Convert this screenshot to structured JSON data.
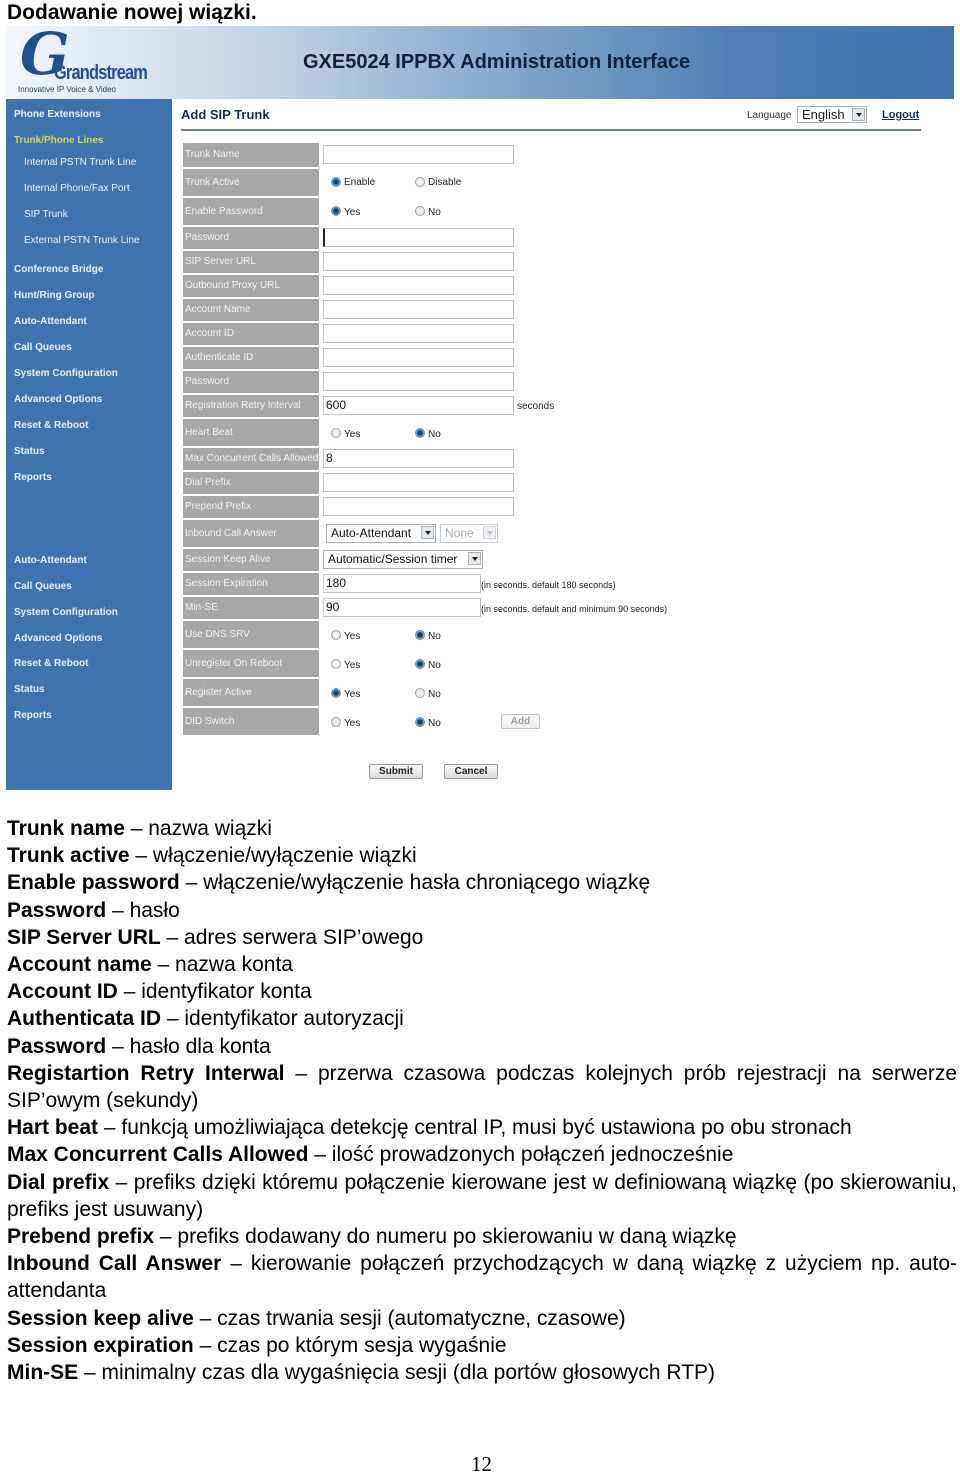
{
  "document": {
    "title": "Dodawanie nowej wiązki.",
    "page_number": "12"
  },
  "app": {
    "logo_text": "Grandstream",
    "logo_tagline": "Innovative IP Voice & Video",
    "title": "GXE5024 IPPBX Administration Interface",
    "page_heading": "Add SIP Trunk",
    "language_label": "Language",
    "language_value": "English",
    "logout": "Logout"
  },
  "sidebar": {
    "items": [
      {
        "label": "Phone Extensions",
        "type": "main"
      },
      {
        "label": "Trunk/Phone Lines",
        "type": "active"
      },
      {
        "label": "Internal PSTN Trunk Line",
        "type": "sub"
      },
      {
        "label": "Internal Phone/Fax Port",
        "type": "sub"
      },
      {
        "label": "SIP Trunk",
        "type": "sub"
      },
      {
        "label": "External PSTN Trunk Line",
        "type": "sub"
      },
      {
        "label": "Conference Bridge",
        "type": "main"
      },
      {
        "label": "Hunt/Ring Group",
        "type": "main"
      },
      {
        "label": "Auto-Attendant",
        "type": "main"
      },
      {
        "label": "Call Queues",
        "type": "main"
      },
      {
        "label": "System Configuration",
        "type": "main"
      },
      {
        "label": "Advanced Options",
        "type": "main"
      },
      {
        "label": "Reset & Reboot",
        "type": "main"
      },
      {
        "label": "Status",
        "type": "main"
      },
      {
        "label": "Reports",
        "type": "main"
      },
      {
        "label": "Auto-Attendant",
        "type": "main"
      },
      {
        "label": "Call Queues",
        "type": "main"
      },
      {
        "label": "System Configuration",
        "type": "main"
      },
      {
        "label": "Advanced Options",
        "type": "main"
      },
      {
        "label": "Reset & Reboot",
        "type": "main"
      },
      {
        "label": "Status",
        "type": "main"
      },
      {
        "label": "Reports",
        "type": "main"
      }
    ]
  },
  "form": {
    "trunk_name": {
      "label": "Trunk Name",
      "value": ""
    },
    "trunk_active": {
      "label": "Trunk Active",
      "options": [
        "Enable",
        "Disable"
      ],
      "selected": "Enable"
    },
    "enable_password": {
      "label": "Enable Password",
      "options": [
        "Yes",
        "No"
      ],
      "selected": "Yes"
    },
    "password": {
      "label": "Password",
      "value": ""
    },
    "sip_server_url": {
      "label": "SIP Server URL",
      "value": ""
    },
    "outbound_proxy_url": {
      "label": "Outbound Proxy URL",
      "value": ""
    },
    "account_name": {
      "label": "Account Name",
      "value": ""
    },
    "account_id": {
      "label": "Account ID",
      "value": ""
    },
    "authenticate_id": {
      "label": "Authenticate ID",
      "value": ""
    },
    "account_password": {
      "label": "Password",
      "value": ""
    },
    "registration_retry_interval": {
      "label": "Registration Retry Interval",
      "value": "600",
      "unit": "seconds"
    },
    "heart_beat": {
      "label": "Heart Beat",
      "options": [
        "Yes",
        "No"
      ],
      "selected": "No"
    },
    "max_concurrent_calls": {
      "label": "Max Concurrent Calls Allowed",
      "value": "8"
    },
    "dial_prefix": {
      "label": "Dial Prefix",
      "value": ""
    },
    "prepend_prefix": {
      "label": "Prepend Prefix",
      "value": ""
    },
    "inbound_call_answer": {
      "label": "Inbound Call Answer",
      "value": "Auto-Attendant",
      "secondary_value": "None"
    },
    "session_keep_alive": {
      "label": "Session Keep Alive",
      "value": "Automatic/Session timer"
    },
    "session_expiration": {
      "label": "Session Expiration",
      "value": "180",
      "note": "(in seconds. default 180 seconds)"
    },
    "min_se": {
      "label": "Min-SE",
      "value": "90",
      "note": "(in seconds. default and minimum 90 seconds)"
    },
    "use_dns_srv": {
      "label": "Use DNS SRV",
      "options": [
        "Yes",
        "No"
      ],
      "selected": "No"
    },
    "unregister_on_reboot": {
      "label": "Unregister On Reboot",
      "options": [
        "Yes",
        "No"
      ],
      "selected": "No"
    },
    "register_active": {
      "label": "Register Active",
      "options": [
        "Yes",
        "No"
      ],
      "selected": "Yes"
    },
    "did_switch": {
      "label": "DID Switch",
      "options": [
        "Yes",
        "No"
      ],
      "selected": "No"
    },
    "add_button": "Add",
    "submit_button": "Submit",
    "cancel_button": "Cancel"
  },
  "descriptions": [
    {
      "term": "Trunk name",
      "text": "– nazwa wiązki"
    },
    {
      "term": "Trunk active",
      "text": "– włączenie/wyłączenie wiązki"
    },
    {
      "term": "Enable password",
      "text": "– włączenie/wyłączenie hasła chroniącego wiązkę"
    },
    {
      "term": "Password",
      "text": "– hasło"
    },
    {
      "term": "SIP Server URL",
      "text": "– adres serwera SIP’owego"
    },
    {
      "term": "Account name",
      "text": "– nazwa konta"
    },
    {
      "term": "Account ID",
      "text": "– identyfikator konta"
    },
    {
      "term": "Authenticata ID",
      "text": "– identyfikator autoryzacji"
    },
    {
      "term": "Password",
      "text": "– hasło dla konta"
    },
    {
      "term": "Registartion Retry Interwal",
      "text": "– przerwa czasowa podczas kolejnych prób rejestracji na serwerze SIP’owym (sekundy)"
    },
    {
      "term": "Hart beat",
      "text": "– funkcją umożliwiająca detekcję central IP, musi być ustawiona po obu stronach"
    },
    {
      "term": "Max Concurrent Calls Allowed",
      "text": "– ilość prowadzonych połączeń jednocześnie"
    },
    {
      "term": "Dial prefix",
      "text": "– prefiks dzięki któremu połączenie kierowane jest w definiowaną wiązkę (po skierowaniu, prefiks jest usuwany)"
    },
    {
      "term": "Prebend prefix",
      "text": "– prefiks dodawany do numeru po skierowaniu w daną wiązkę"
    },
    {
      "term": "Inbound Call Answer",
      "text": "– kierowanie połączeń przychodzących w daną wiązkę z użyciem np. auto-attendanta"
    },
    {
      "term": "Session keep alive",
      "text": "– czas trwania sesji (automatyczne, czasowe)"
    },
    {
      "term": "Session expiration",
      "text": "– czas po którym sesja wygaśnie"
    },
    {
      "term": "Min-SE",
      "text": "– minimalny czas dla wygaśnięcia sesji (dla portów głosowych RTP)"
    }
  ]
}
